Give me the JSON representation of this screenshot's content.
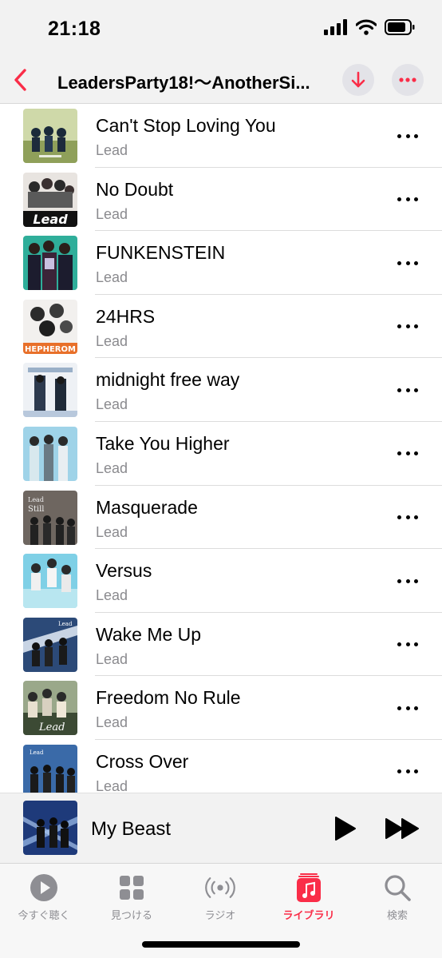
{
  "status_bar": {
    "time": "21:18"
  },
  "nav": {
    "title": "LeadersParty18!〜AnotherSi..."
  },
  "colors": {
    "accent": "#fa2d48",
    "secondary_text": "#8a8a8e",
    "bar_bg": "#f2f2f2"
  },
  "songs": [
    {
      "title": "Can't Stop Loving You",
      "artist": "Lead"
    },
    {
      "title": "No Doubt",
      "artist": "Lead"
    },
    {
      "title": "FUNKENSTEIN",
      "artist": "Lead"
    },
    {
      "title": "24HRS",
      "artist": "Lead"
    },
    {
      "title": "midnight free way",
      "artist": "Lead"
    },
    {
      "title": "Take You Higher",
      "artist": "Lead"
    },
    {
      "title": "Masquerade",
      "artist": "Lead"
    },
    {
      "title": "Versus",
      "artist": "Lead"
    },
    {
      "title": "Wake Me Up",
      "artist": "Lead"
    },
    {
      "title": "Freedom No Rule",
      "artist": "Lead"
    },
    {
      "title": "Cross Over",
      "artist": "Lead"
    }
  ],
  "now_playing": {
    "title": "My Beast"
  },
  "tabs": [
    {
      "label": "今すぐ聴く",
      "icon": "play-circle-icon"
    },
    {
      "label": "見つける",
      "icon": "grid-icon"
    },
    {
      "label": "ラジオ",
      "icon": "radio-icon"
    },
    {
      "label": "ライブラリ",
      "icon": "library-icon",
      "active": true
    },
    {
      "label": "検索",
      "icon": "search-icon"
    }
  ]
}
